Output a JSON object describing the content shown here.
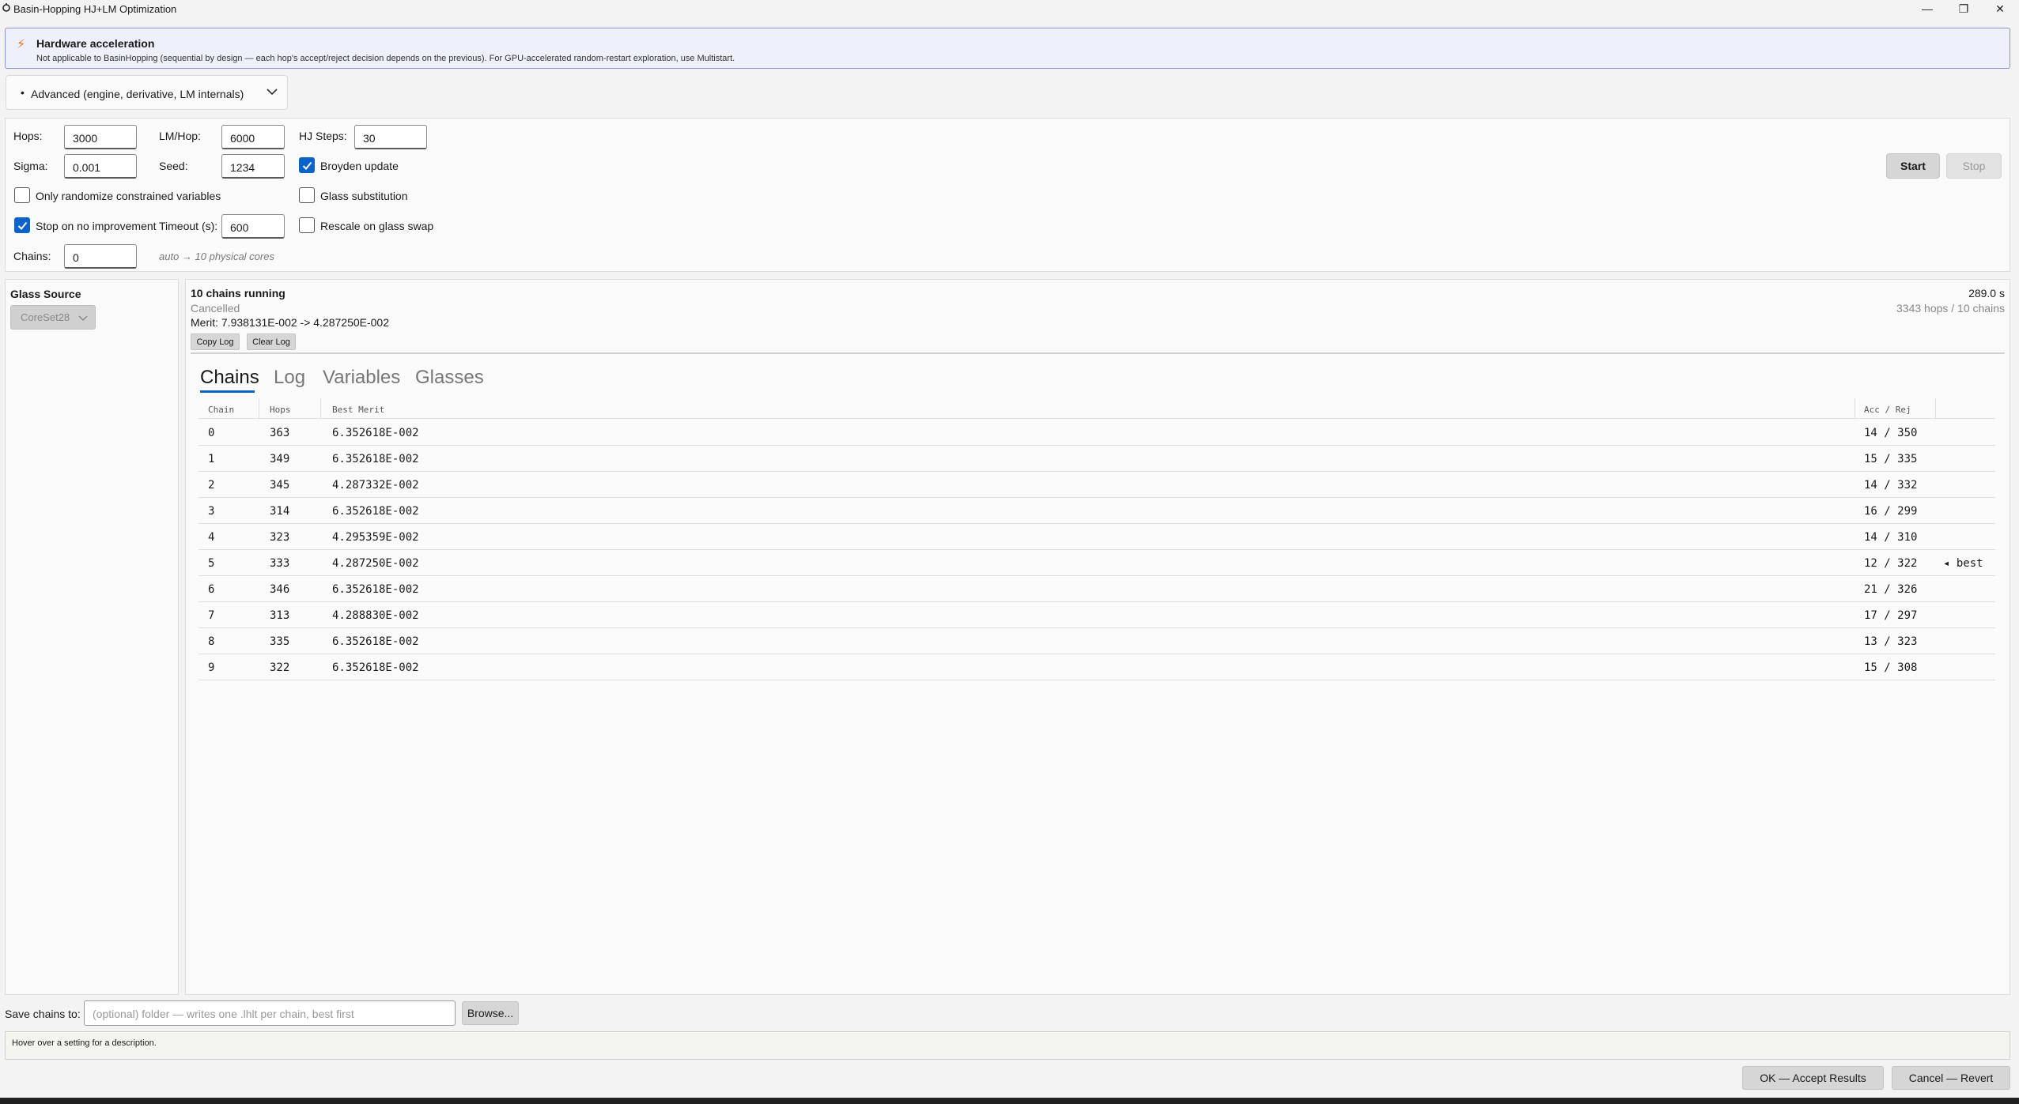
{
  "window": {
    "title": "Basin-Hopping HJ+LM Optimization"
  },
  "hardware": {
    "title": "Hardware acceleration",
    "description": "Not applicable to BasinHopping (sequential by design — each hop's accept/reject decision depends on the previous). For GPU-accelerated random-restart exploration, use Multistart."
  },
  "advanced": {
    "bullet": "•",
    "label": "Advanced (engine, derivative, LM internals)"
  },
  "settings": {
    "hops_label": "Hops:",
    "hops_value": "3000",
    "lm_label": "LM/Hop:",
    "lm_value": "6000",
    "hj_label": "HJ Steps:",
    "hj_value": "30",
    "sigma_label": "Sigma:",
    "sigma_value": "0.001",
    "seed_label": "Seed:",
    "seed_value": "1234",
    "broyden_label": "Broyden update",
    "broyden_checked": true,
    "only_random_label": "Only randomize constrained variables",
    "only_random_checked": false,
    "glass_sub_label": "Glass substitution",
    "glass_sub_checked": false,
    "stop_label": "Stop on no improvement",
    "stop_checked": true,
    "timeout_label": "Timeout (s):",
    "timeout_value": "600",
    "rescale_label": "Rescale on glass swap",
    "rescale_checked": false,
    "chains_label": "Chains:",
    "chains_value": "0",
    "chains_hint": "auto → 10 physical cores",
    "start_label": "Start",
    "stop_button_label": "Stop"
  },
  "glass": {
    "title": "Glass Source",
    "value": "CoreSet28"
  },
  "status": {
    "running": "10 chains running",
    "state": "Cancelled",
    "merit": "Merit: 7.938131E-002 -> 4.287250E-002",
    "time": "289.0 s",
    "hops_chains": "3343 hops / 10 chains",
    "copy_log": "Copy Log",
    "clear_log": "Clear Log"
  },
  "tabs": [
    "Chains",
    "Log",
    "Variables",
    "Glasses"
  ],
  "table": {
    "headers": [
      "Chain",
      "Hops",
      "Best Merit",
      "Acc / Rej"
    ],
    "rows": [
      {
        "chain": "0",
        "hops": "363",
        "merit": "6.352618E-002",
        "accrej": "14 / 350",
        "note": ""
      },
      {
        "chain": "1",
        "hops": "349",
        "merit": "6.352618E-002",
        "accrej": "15 / 335",
        "note": ""
      },
      {
        "chain": "2",
        "hops": "345",
        "merit": "4.287332E-002",
        "accrej": "14 / 332",
        "note": ""
      },
      {
        "chain": "3",
        "hops": "314",
        "merit": "6.352618E-002",
        "accrej": "16 / 299",
        "note": ""
      },
      {
        "chain": "4",
        "hops": "323",
        "merit": "4.295359E-002",
        "accrej": "14 / 310",
        "note": ""
      },
      {
        "chain": "5",
        "hops": "333",
        "merit": "4.287250E-002",
        "accrej": "12 / 322",
        "note": "◂ best"
      },
      {
        "chain": "6",
        "hops": "346",
        "merit": "6.352618E-002",
        "accrej": "21 / 326",
        "note": ""
      },
      {
        "chain": "7",
        "hops": "313",
        "merit": "4.288830E-002",
        "accrej": "17 / 297",
        "note": ""
      },
      {
        "chain": "8",
        "hops": "335",
        "merit": "6.352618E-002",
        "accrej": "13 / 323",
        "note": ""
      },
      {
        "chain": "9",
        "hops": "322",
        "merit": "6.352618E-002",
        "accrej": "15 / 308",
        "note": ""
      }
    ]
  },
  "save": {
    "label": "Save chains to:",
    "placeholder": "(optional) folder — writes one .lhlt per chain, best first",
    "browse": "Browse..."
  },
  "hover_hint": "Hover over a setting for a description.",
  "footer": {
    "ok": "OK — Accept Results",
    "cancel": "Cancel — Revert"
  },
  "colors": {
    "accent": "#0a63c9",
    "bolt": "#e8741a",
    "banner_border": "#8a93d9"
  }
}
